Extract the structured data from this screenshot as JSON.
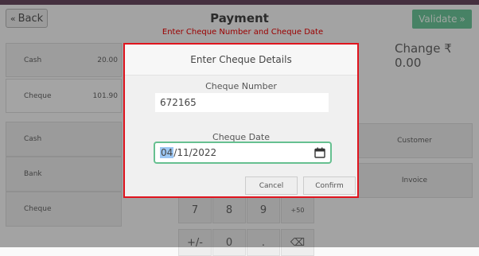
{
  "header": {
    "back_label": "Back",
    "title": "Payment",
    "error_message": "Enter Cheque Number and Cheque Date",
    "validate_label": "Validate",
    "change_text": "Change ₹ 0.00"
  },
  "payment_lines": [
    {
      "method": "Cash",
      "amount": "20.00"
    },
    {
      "method": "Cheque",
      "amount": "101.90"
    }
  ],
  "payment_methods": [
    "Cash",
    "Bank",
    "Cheque"
  ],
  "side_buttons": {
    "customer": "Customer",
    "invoice": "Invoice"
  },
  "numpad": {
    "row3": [
      "7",
      "8",
      "9",
      "+50"
    ],
    "row4": [
      "+/-",
      "0",
      ".",
      "⌫"
    ]
  },
  "modal": {
    "title": "Enter Cheque Details",
    "cheque_number_label": "Cheque Number",
    "cheque_number_value": "672165",
    "cheque_date_label": "Cheque Date",
    "cheque_date_month": "04",
    "cheque_date_rest": "/11/2022",
    "cancel_label": "Cancel",
    "confirm_label": "Confirm"
  },
  "colors": {
    "validate": "#6ec89b",
    "error_text": "#ee0000",
    "modal_border": "#e0141e",
    "date_focus": "#66c090"
  }
}
